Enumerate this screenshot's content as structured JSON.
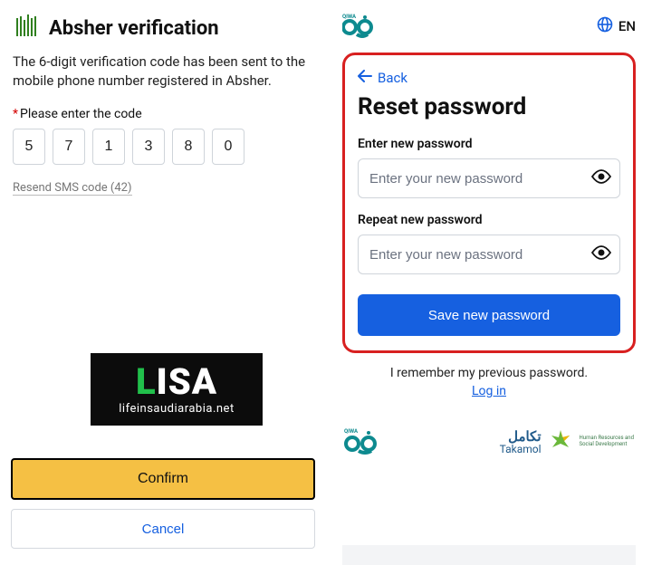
{
  "left": {
    "title": "Absher verification",
    "desc": "The 6-digit verification code has been sent to the mobile phone number registered in Absher.",
    "code_label": "Please enter the code",
    "code": [
      "5",
      "7",
      "1",
      "3",
      "8",
      "0"
    ],
    "resend": "Resend SMS code (42)",
    "confirm": "Confirm",
    "cancel": "Cancel",
    "lisa_main": "LISA",
    "lisa_sub": "lifeinsaudiarabia.net"
  },
  "right": {
    "lang": "EN",
    "back": "Back",
    "title": "Reset password",
    "new_pw_label": "Enter new password",
    "new_pw_ph": "Enter your new password",
    "repeat_label": "Repeat new password",
    "repeat_ph": "Enter your new password",
    "save": "Save new password",
    "remember": "I remember my previous password.",
    "login": "Log in",
    "footer": {
      "qiwa": "QIWA",
      "takamol_ar": "تكامل",
      "takamol_en": "Takamol",
      "hrsd1": "Human Resources and",
      "hrsd2": "Social Development"
    }
  },
  "colors": {
    "accent": "#1660e0",
    "confirm_bg": "#f5c044",
    "highlight": "#d82020",
    "absher_green": "#2f7f1e"
  }
}
